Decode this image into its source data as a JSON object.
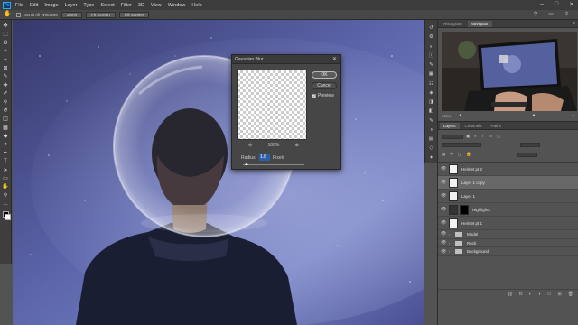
{
  "app": {
    "logo": "Ps"
  },
  "menu": [
    "File",
    "Edit",
    "Image",
    "Layer",
    "Type",
    "Select",
    "Filter",
    "3D",
    "View",
    "Window",
    "Help"
  ],
  "window_controls": [
    "–",
    "□",
    "✕"
  ],
  "options_bar": {
    "tool_icon": "hand-icon",
    "scroll_all_label": "Scroll All Windows",
    "btn_100": "100%",
    "btn_fit": "Fit Screen",
    "btn_fill": "Fill Screen"
  },
  "toolbar": [
    "move-icon",
    "marquee-icon",
    "lasso-icon",
    "magic-wand-icon",
    "crop-icon",
    "frame-icon",
    "eyedropper-icon",
    "healing-icon",
    "brush-icon",
    "stamp-icon",
    "history-brush-icon",
    "eraser-icon",
    "gradient-icon",
    "blur-icon",
    "dodge-icon",
    "pen-icon",
    "type-icon",
    "path-select-icon",
    "shape-icon",
    "hand-icon",
    "zoom-icon",
    "more-icon"
  ],
  "toolbar_glyphs": [
    "✥",
    "⬚",
    "ʘ",
    "✧",
    "⌗",
    "⊠",
    "✎",
    "✚",
    "✐",
    "⚲",
    "↺",
    "◫",
    "▦",
    "◆",
    "●",
    "✒",
    "T",
    "➤",
    "▭",
    "✋",
    "⚲",
    "…"
  ],
  "dialog": {
    "title": "Gaussian Blur",
    "ok": "OK",
    "cancel": "Cancel",
    "preview_label": "Preview",
    "preview_checked": "✓",
    "zoom_value": "100%",
    "zoom_out": "⊖",
    "zoom_in": "⊕",
    "radius_label": "Radius:",
    "radius_value": "1.8",
    "radius_unit": "Pixels",
    "close": "✕"
  },
  "navigator": {
    "tabs": [
      "Histogram",
      "Navigator"
    ],
    "zoom_readout": "100%",
    "menu": "≡"
  },
  "layers_panel": {
    "tabs": [
      "Layers",
      "Channels",
      "Paths"
    ],
    "menu": "≡",
    "layers": [
      {
        "name": "Helmet pt 2",
        "type": "pixel"
      },
      {
        "name": "Layer 1 copy",
        "type": "pixel"
      },
      {
        "name": "Layer 1",
        "type": "pixel"
      },
      {
        "name": "Highlights",
        "type": "adjustment"
      },
      {
        "name": "Helmet pt 1",
        "type": "pixel"
      },
      {
        "name": "Model",
        "type": "group"
      },
      {
        "name": "Rock",
        "type": "group"
      },
      {
        "name": "Background",
        "type": "group"
      }
    ],
    "bottom_icons": [
      "link-icon",
      "fx-icon",
      "mask-icon",
      "adjustment-icon",
      "folder-icon",
      "new-layer-icon",
      "trash-icon"
    ],
    "bottom_glyphs": [
      "⛓",
      "fx",
      "◐",
      "◑",
      "▭",
      "⊞",
      "🗑"
    ],
    "eye": "👁"
  },
  "sidestrip": [
    "history-icon",
    "properties-icon",
    "adjust-icon",
    "info-icon",
    "brush-settings-icon",
    "swatches-icon",
    "libraries-icon",
    "3d-icon",
    "layers-icon",
    "channels-icon",
    "paths-icon",
    "color-icon",
    "gradients-icon",
    "patterns-icon",
    "styles-icon"
  ],
  "sidestrip_glyphs": [
    "↺",
    "⚙",
    "◐",
    "ⓘ",
    "✎",
    "▦",
    "☷",
    "◈",
    "◨",
    "◧",
    "✎",
    "◑",
    "▤",
    "◇",
    "✦"
  ],
  "colors": {
    "accent": "#31a8ff",
    "panel": "#535353",
    "dark": "#3e3e3e"
  }
}
